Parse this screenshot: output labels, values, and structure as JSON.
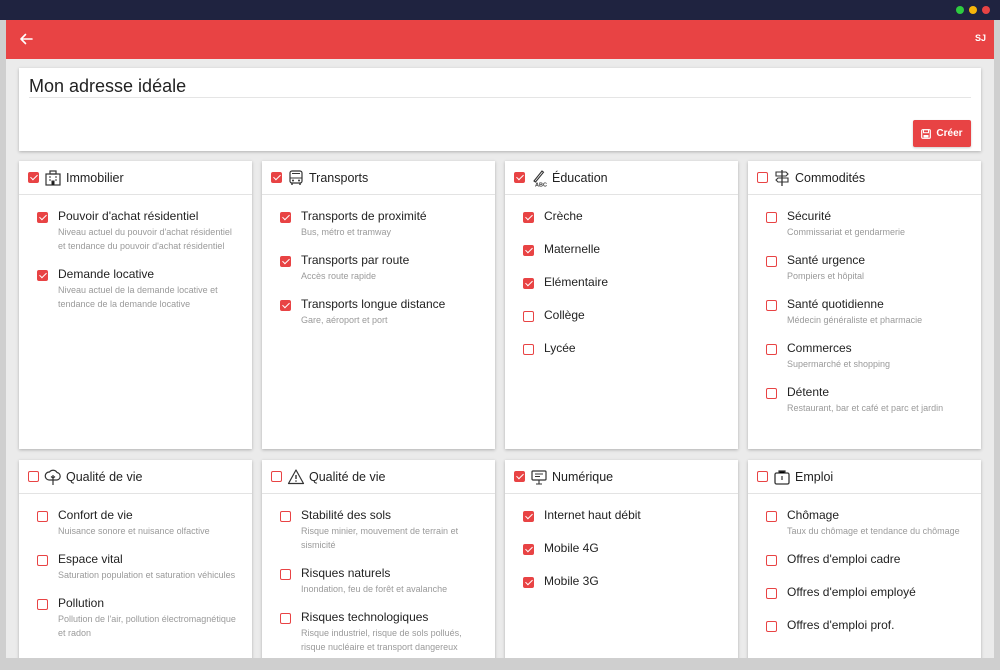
{
  "window": {
    "dots": [
      "#2ecc40",
      "#f5b50a",
      "#e84344"
    ]
  },
  "appbar": {
    "back_icon": "arrow-left-icon",
    "user_initials": "SJ"
  },
  "header": {
    "title": "Mon adresse idéale",
    "create_label": "Créer",
    "create_icon": "floppy-disk-icon"
  },
  "colors": {
    "accent": "#e84344",
    "titlebar": "#1f2340"
  },
  "cards": [
    {
      "label": "Immobilier",
      "icon": "building-icon",
      "checked": true,
      "items": [
        {
          "label": "Pouvoir d'achat résidentiel",
          "desc": "Niveau actuel du pouvoir d'achat résidentiel et tendance du pouvoir d'achat résidentiel",
          "checked": true
        },
        {
          "label": "Demande locative",
          "desc": "Niveau actuel de la demande locative et tendance de la demande locative",
          "checked": true
        }
      ]
    },
    {
      "label": "Transports",
      "icon": "bus-icon",
      "checked": true,
      "items": [
        {
          "label": "Transports de proximité",
          "desc": "Bus, métro et tramway",
          "checked": true
        },
        {
          "label": "Transports par route",
          "desc": "Accès route rapide",
          "checked": true
        },
        {
          "label": "Transports longue distance",
          "desc": "Gare, aéroport et port",
          "checked": true
        }
      ]
    },
    {
      "label": "Éducation",
      "icon": "abc-pencil-icon",
      "checked": true,
      "items": [
        {
          "label": "Crèche",
          "desc": "",
          "checked": true
        },
        {
          "label": "Maternelle",
          "desc": "",
          "checked": true
        },
        {
          "label": "Elémentaire",
          "desc": "",
          "checked": true
        },
        {
          "label": "Collège",
          "desc": "",
          "checked": false
        },
        {
          "label": "Lycée",
          "desc": "",
          "checked": false
        }
      ]
    },
    {
      "label": "Commodités",
      "icon": "signpost-icon",
      "checked": false,
      "items": [
        {
          "label": "Sécurité",
          "desc": "Commissariat et gendarmerie",
          "checked": false
        },
        {
          "label": "Santé urgence",
          "desc": "Pompiers et hôpital",
          "checked": false
        },
        {
          "label": "Santé quotidienne",
          "desc": "Médecin généraliste et pharmacie",
          "checked": false
        },
        {
          "label": "Commerces",
          "desc": "Supermarché et shopping",
          "checked": false
        },
        {
          "label": "Détente",
          "desc": "Restaurant, bar et café et parc et jardin",
          "checked": false
        }
      ]
    },
    {
      "label": "Qualité de vie",
      "icon": "tree-icon",
      "checked": false,
      "items": [
        {
          "label": "Confort de vie",
          "desc": "Nuisance sonore et nuisance olfactive",
          "checked": false
        },
        {
          "label": "Espace vital",
          "desc": "Saturation population et saturation véhicules",
          "checked": false
        },
        {
          "label": "Pollution",
          "desc": "Pollution de l'air, pollution électromagnétique et radon",
          "checked": false
        }
      ]
    },
    {
      "label": "Qualité de vie",
      "icon": "warning-icon",
      "checked": false,
      "items": [
        {
          "label": "Stabilité des sols",
          "desc": "Risque minier, mouvement de terrain et sismicité",
          "checked": false
        },
        {
          "label": "Risques naturels",
          "desc": "Inondation, feu de forêt et avalanche",
          "checked": false
        },
        {
          "label": "Risques technologiques",
          "desc": "Risque industriel, risque de sols pollués, risque nucléaire et transport dangereux",
          "checked": false
        }
      ]
    },
    {
      "label": "Numérique",
      "icon": "monitor-icon",
      "checked": true,
      "items": [
        {
          "label": "Internet haut débit",
          "desc": "",
          "checked": true
        },
        {
          "label": "Mobile 4G",
          "desc": "",
          "checked": true
        },
        {
          "label": "Mobile 3G",
          "desc": "",
          "checked": true
        }
      ]
    },
    {
      "label": "Emploi",
      "icon": "briefcase-icon",
      "checked": false,
      "items": [
        {
          "label": "Chômage",
          "desc": "Taux du chômage et tendance du chômage",
          "checked": false
        },
        {
          "label": "Offres d'emploi cadre",
          "desc": "",
          "checked": false
        },
        {
          "label": "Offres d'emploi employé",
          "desc": "",
          "checked": false
        },
        {
          "label": "Offres d'emploi prof.",
          "desc": "",
          "checked": false
        }
      ]
    }
  ]
}
